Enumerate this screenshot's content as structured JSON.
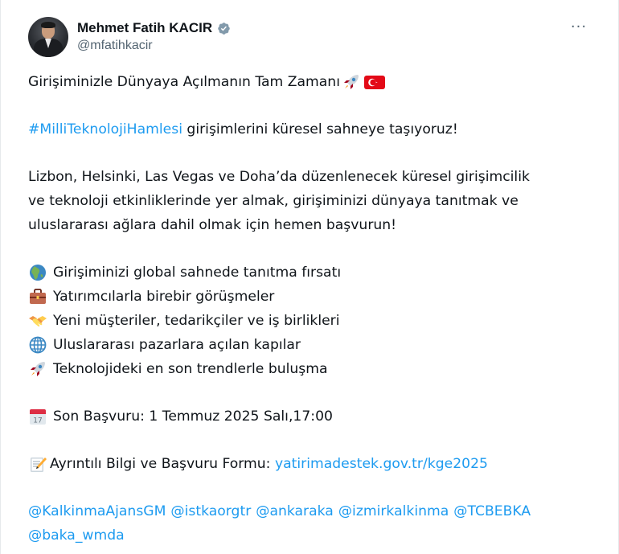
{
  "author": {
    "display_name": "Mehmet Fatih KACIR",
    "handle": "@mfatihkacir"
  },
  "more_label": "···",
  "tweet": {
    "headline": "Girişiminizle Dünyaya Açılmanın Tam Zamanı",
    "headline_emojis": [
      "rocket-icon",
      "turkey-flag-icon"
    ],
    "hashtag": "#MilliTeknolojiHamlesi",
    "hashtag_rest": " girişimlerini küresel sahneye taşıyoruz!",
    "paragraph_lines": [
      "Lizbon, Helsinki, Las Vegas ve Doha’da düzenlenecek küresel girişimcilik",
      "ve teknoloji etkinliklerinde yer almak, girişiminizi dünyaya tanıtmak ve",
      "uluslararası ağlara dahil olmak için hemen başvurun!"
    ],
    "bullets": [
      {
        "icon": "globe-africa-icon",
        "text": "Girişiminizi global sahnede tanıtma fırsatı"
      },
      {
        "icon": "briefcase-icon",
        "text": "Yatırımcılarla birebir görüşmeler"
      },
      {
        "icon": "handshake-icon",
        "text": "Yeni müşteriler, tedarikçiler ve iş birlikleri"
      },
      {
        "icon": "globe-meridians-icon",
        "text": "Uluslararası pazarlara açılan kapılar"
      },
      {
        "icon": "rocket-icon",
        "text": "Teknolojideki en son trendlerle buluşma"
      }
    ],
    "deadline": {
      "icon": "calendar-icon",
      "calendar_day": "17",
      "text": "Son Başvuru: 1 Temmuz 2025 Salı,17:00"
    },
    "info": {
      "icon": "memo-icon",
      "label": "Ayrıntılı Bilgi ve Başvuru Formu: ",
      "link": "yatirimadestek.gov.tr/kge2025"
    },
    "mentions_line1": [
      "@KalkinmaAjansGM",
      "@istkaorgtr",
      "@ankaraka",
      "@izmirkalkinma",
      "@TCBEBKA"
    ],
    "mentions_line2": [
      "@baka_wmda"
    ]
  },
  "colors": {
    "link": "#1d9bf0",
    "text": "#0f1419",
    "secondary_text": "#536471",
    "verified_badge": "#829aab"
  }
}
